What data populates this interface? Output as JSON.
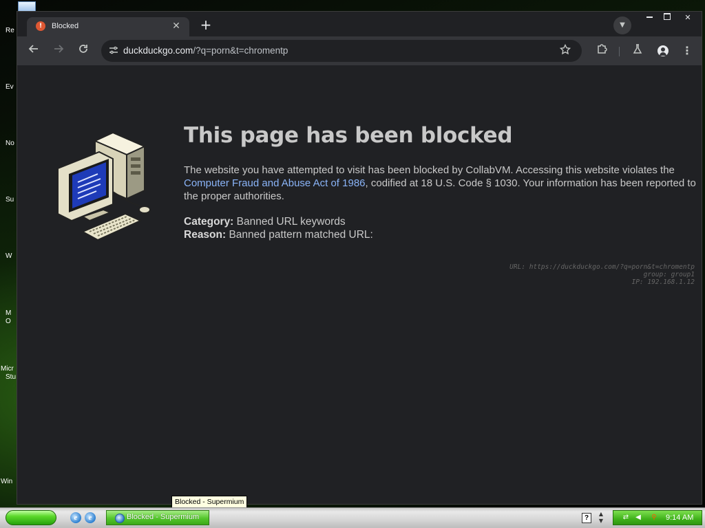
{
  "desktop": {
    "icon_labels": [
      "Re",
      "Ev",
      "No",
      "Su",
      "W",
      "M",
      "O",
      "Micr",
      "Stu",
      "Win"
    ]
  },
  "browser": {
    "tab_title": "Blocked",
    "tab_favicon_glyph": "!",
    "url_domain": "duckduckgo.com",
    "url_rest": "/?q=porn&t=chromentp"
  },
  "page": {
    "title": "This page has been blocked",
    "message_before": "The website you have attempted to visit has been blocked by CollabVM. Accessing this website violates the ",
    "message_link": "Computer Fraud and Abuse Act of 1986",
    "message_after": ", codified at 18 U.S. Code § 1030. Your information has been reported to the proper authorities.",
    "category_label": "Category:",
    "category_value": "Banned URL keywords",
    "reason_label": "Reason:",
    "reason_value": "Banned pattern matched URL:",
    "debug_url": "URL: https://duckduckgo.com/?q=porn&t=chromentp",
    "debug_group": "group: group1",
    "debug_ip": "IP: 192.168.1.12",
    "link_color": "#8ab4f8"
  },
  "tooltip": "Blocked - Supermium",
  "taskbar": {
    "task_label": "Blocked - Supermium",
    "help_glyph": "?",
    "clock": "9:14 AM",
    "accent": "#3fb11a"
  },
  "icons": {
    "back": "arrow-left-icon",
    "forward": "arrow-right-icon",
    "reload": "reload-icon",
    "star": "star-icon",
    "extensions": "puzzle-icon",
    "labs": "flask-icon",
    "profile": "person-icon",
    "menu": "kebab-menu-icon"
  }
}
